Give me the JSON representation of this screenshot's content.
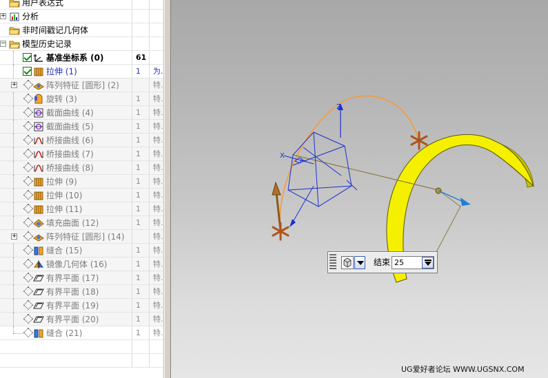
{
  "part_navigator": {
    "rows": [
      {
        "name": "用户表达式",
        "num": "",
        "type": "",
        "style": "plain"
      },
      {
        "name": "分析",
        "num": "",
        "type": "",
        "style": "plain"
      },
      {
        "name": "非时间戳记几何体",
        "num": "",
        "type": "",
        "style": "plain"
      },
      {
        "name": "模型历史记录",
        "num": "",
        "type": "",
        "style": "plain"
      },
      {
        "name": "基准坐标系 (0)",
        "num": "61",
        "type": "",
        "style": "bold"
      },
      {
        "name": "拉伸 (1)",
        "num": "1",
        "type": "为.",
        "style": "blue"
      },
      {
        "name": "阵列特征 [圆形] (2)",
        "num": "",
        "type": "特.",
        "style": "grey"
      },
      {
        "name": "旋转 (3)",
        "num": "1",
        "type": "特.",
        "style": "grey"
      },
      {
        "name": "截面曲线 (4)",
        "num": "1",
        "type": "特.",
        "style": "grey"
      },
      {
        "name": "截面曲线 (5)",
        "num": "1",
        "type": "特.",
        "style": "grey"
      },
      {
        "name": "桥接曲线 (6)",
        "num": "1",
        "type": "特.",
        "style": "grey"
      },
      {
        "name": "桥接曲线 (7)",
        "num": "1",
        "type": "特.",
        "style": "grey"
      },
      {
        "name": "桥接曲线 (8)",
        "num": "1",
        "type": "特.",
        "style": "grey"
      },
      {
        "name": "拉伸 (9)",
        "num": "1",
        "type": "特.",
        "style": "grey"
      },
      {
        "name": "拉伸 (10)",
        "num": "1",
        "type": "特.",
        "style": "grey"
      },
      {
        "name": "拉伸 (11)",
        "num": "1",
        "type": "特.",
        "style": "grey"
      },
      {
        "name": "填充曲面 (12)",
        "num": "1",
        "type": "特.",
        "style": "grey"
      },
      {
        "name": "阵列特征 [圆形] (14)",
        "num": "",
        "type": "特.",
        "style": "grey"
      },
      {
        "name": "缝合 (15)",
        "num": "1",
        "type": "特.",
        "style": "grey"
      },
      {
        "name": "镜像几何体 (16)",
        "num": "1",
        "type": "特.",
        "style": "grey"
      },
      {
        "name": "有界平面 (17)",
        "num": "1",
        "type": "特.",
        "style": "grey"
      },
      {
        "name": "有界平面 (18)",
        "num": "1",
        "type": "特.",
        "style": "grey"
      },
      {
        "name": "有界平面 (19)",
        "num": "1",
        "type": "特.",
        "style": "grey"
      },
      {
        "name": "有界平面 (20)",
        "num": "1",
        "type": "特.",
        "style": "grey"
      },
      {
        "name": "缝合 (21)",
        "num": "1",
        "type": "特.",
        "style": "grey"
      }
    ]
  },
  "graphics": {
    "csys_labels": {
      "z": "Z",
      "x": "X"
    },
    "dynamic_input": {
      "label": "结束",
      "value": "25"
    },
    "colors": {
      "extrude_face": "#f5f000",
      "arc": "#f59a3c",
      "handle": "#b0541c",
      "axis_blue": "#1a2fd0",
      "vector_arrow": "#1e7fd8"
    }
  },
  "watermark": "UG爱好者论坛 WWW.UGSNX.COM"
}
